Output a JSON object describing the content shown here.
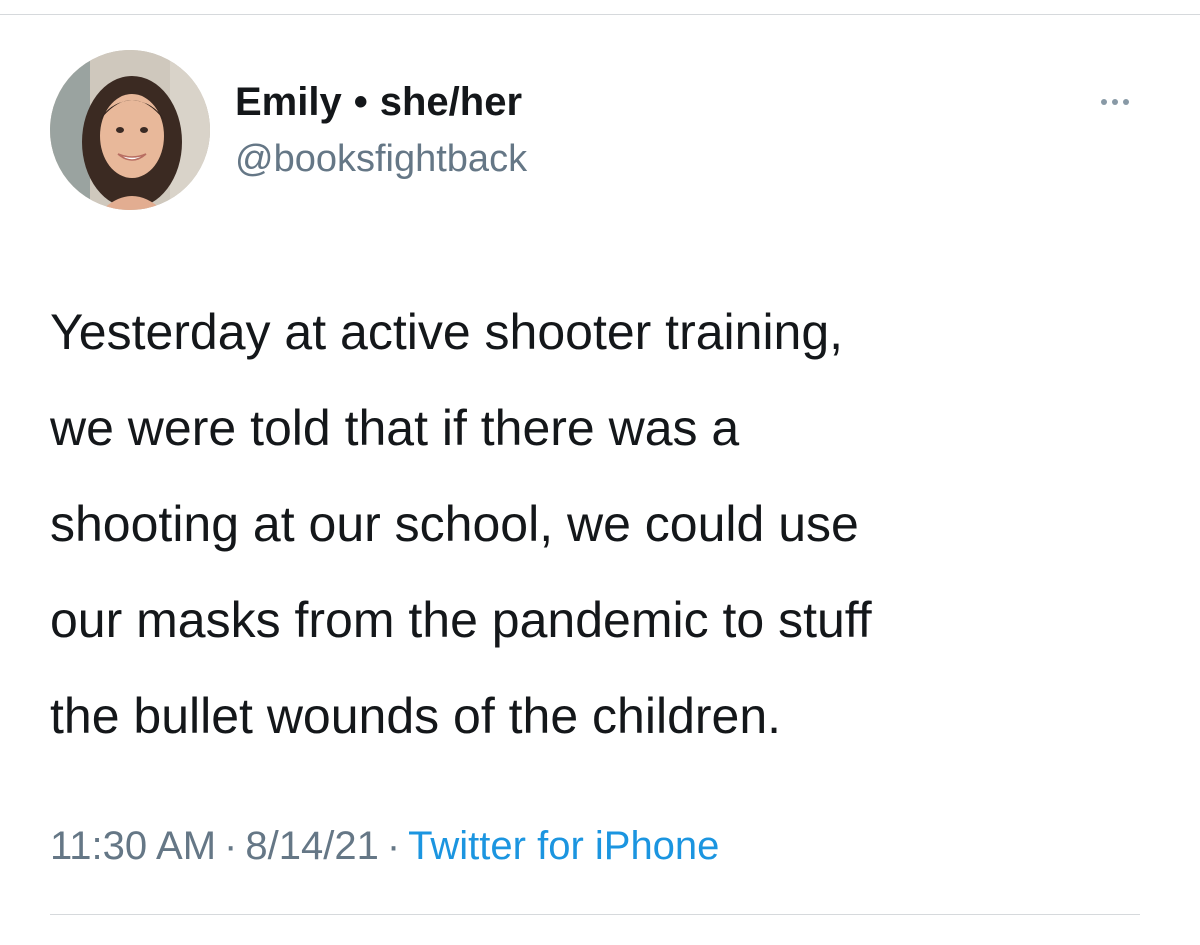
{
  "tweet": {
    "author": {
      "name": "Emily",
      "separator": "•",
      "pronouns": "she/her",
      "handle": "@booksfightback",
      "avatar_icon": "profile-photo-avatar"
    },
    "more_icon": "more-horizontal-icon",
    "text_lines": [
      "Yesterday at active shooter training,",
      "we were told that if there was a",
      "shooting at our school, we could use",
      "our masks from the pandemic to stuff",
      "the bullet wounds of the children."
    ],
    "meta": {
      "time": "11:30 AM",
      "separator": "·",
      "date": "8/14/21",
      "source": "Twitter for iPhone"
    }
  },
  "colors": {
    "text": "#14171a",
    "secondary": "#657786",
    "link": "#1b95e0",
    "divider": "#d6d9dc"
  }
}
